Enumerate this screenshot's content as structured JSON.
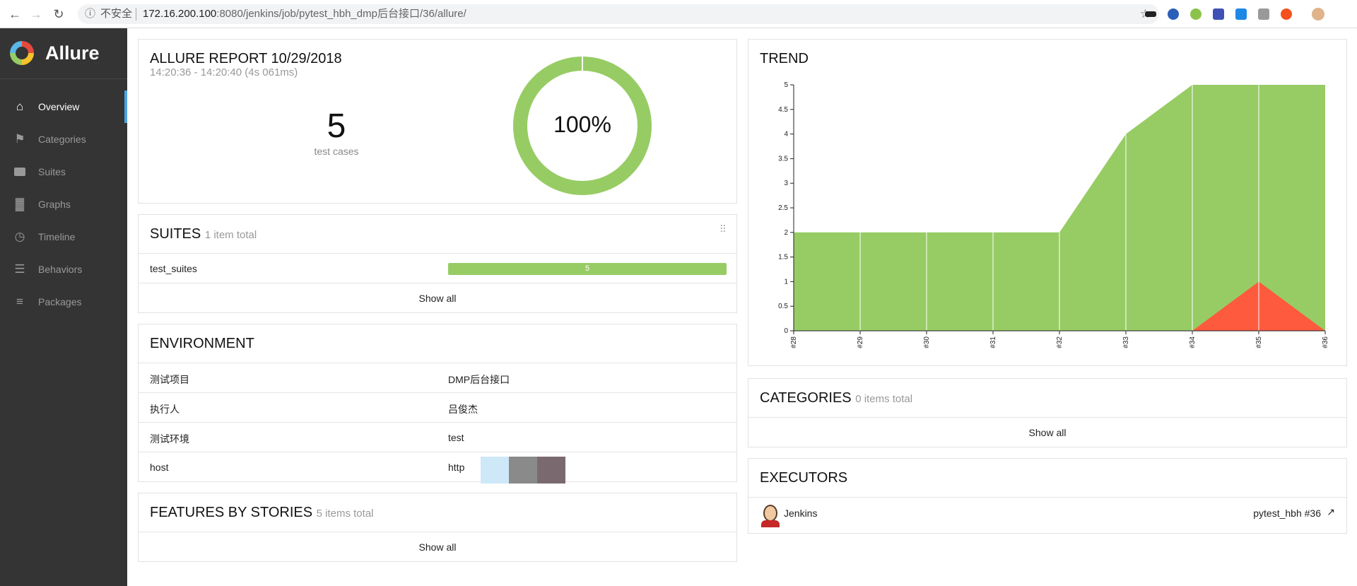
{
  "browser": {
    "insecure_label": "不安全",
    "url_host": "172.16.200.100",
    "url_rest": ":8080/jenkins/job/pytest_hbh_dmp后台接口/36/allure/"
  },
  "sidebar": {
    "brand": "Allure",
    "items": [
      {
        "label": "Overview",
        "icon": "home-icon"
      },
      {
        "label": "Categories",
        "icon": "flag-icon"
      },
      {
        "label": "Suites",
        "icon": "briefcase-icon"
      },
      {
        "label": "Graphs",
        "icon": "bar-chart-icon"
      },
      {
        "label": "Timeline",
        "icon": "clock-icon"
      },
      {
        "label": "Behaviors",
        "icon": "list-icon"
      },
      {
        "label": "Packages",
        "icon": "align-left-icon"
      }
    ]
  },
  "overview": {
    "title": "ALLURE REPORT 10/29/2018",
    "time": "14:20:36 - 14:20:40 (4s 061ms)",
    "count": "5",
    "count_label": "test cases",
    "percent": "100%",
    "pass_rate": 1.0
  },
  "suites": {
    "title": "SUITES",
    "subtitle": "1 item total",
    "rows": [
      {
        "name": "test_suites",
        "count": "5",
        "fraction_passed": 1.0
      }
    ],
    "show_all": "Show all"
  },
  "environment": {
    "title": "ENVIRONMENT",
    "rows": [
      {
        "key": "测试项目",
        "value": "DMP后台接口"
      },
      {
        "key": "执行人",
        "value": "吕俊杰"
      },
      {
        "key": "测试环境",
        "value": "test"
      },
      {
        "key": "host",
        "value": "http"
      }
    ]
  },
  "features": {
    "title": "FEATURES BY STORIES",
    "subtitle": "5 items total",
    "show_all": "Show all"
  },
  "trend": {
    "title": "TREND"
  },
  "categories": {
    "title": "CATEGORIES",
    "subtitle": "0 items total",
    "show_all": "Show all"
  },
  "executors": {
    "title": "EXECUTORS",
    "name": "Jenkins",
    "build": "pytest_hbh #36"
  },
  "colors": {
    "passed": "#97cc64",
    "failed": "#fd5a3e",
    "sidebar": "#343434"
  },
  "chart_data": {
    "type": "area",
    "x": [
      "#28",
      "#29",
      "#30",
      "#31",
      "#32",
      "#33",
      "#34",
      "#35",
      "#36"
    ],
    "ylim": [
      0,
      5
    ],
    "yticks": [
      "0",
      "0.5",
      "1",
      "1.5",
      "2",
      "2.5",
      "3",
      "3.5",
      "4",
      "4.5",
      "5"
    ],
    "series": [
      {
        "values": [
          2,
          2,
          2,
          2,
          2,
          4,
          5,
          5,
          5
        ],
        "color": "#97cc64"
      },
      {
        "values": [
          0,
          0,
          0,
          0,
          0,
          0,
          0,
          1,
          0
        ],
        "color": "#fd5a3e"
      }
    ],
    "grid": false
  }
}
